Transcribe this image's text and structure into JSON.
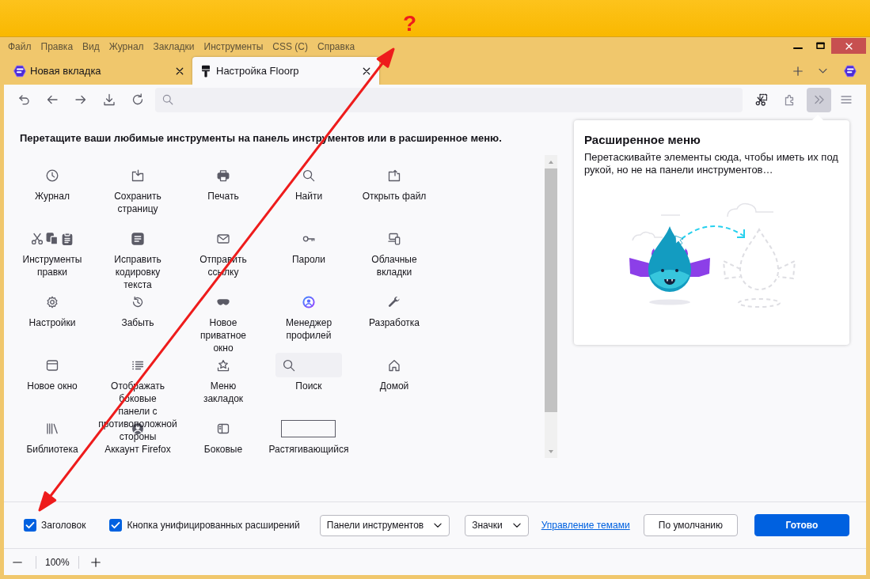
{
  "menu_bar": {
    "items": [
      "Файл",
      "Правка",
      "Вид",
      "Журнал",
      "Закладки",
      "Инструменты",
      "CSS (C)",
      "Справка"
    ]
  },
  "tabs": [
    {
      "title": "Новая вкладка",
      "selected": false
    },
    {
      "title": "Настройка Floorp",
      "selected": true
    }
  ],
  "toolbar": {
    "overflow_button": {
      "active": true
    }
  },
  "customize": {
    "heading": "Перетащите ваши любимые инструменты на панель инструментов или в расширенное меню.",
    "items": [
      {
        "label": "Журнал",
        "kind": "button"
      },
      {
        "label": "Сохранить\nстраницу",
        "kind": "button"
      },
      {
        "label": "Печать",
        "kind": "button"
      },
      {
        "label": "Найти",
        "kind": "button"
      },
      {
        "label": "Открыть файл",
        "kind": "button"
      },
      {
        "label": "Инструменты\nправки",
        "kind": "button"
      },
      {
        "label": "Исправить\nкодировку\nтекста",
        "kind": "button"
      },
      {
        "label": "Отправить\nссылку",
        "kind": "button"
      },
      {
        "label": "Пароли",
        "kind": "button"
      },
      {
        "label": "Облачные\nвкладки",
        "kind": "button"
      },
      {
        "label": "Настройки",
        "kind": "button"
      },
      {
        "label": "Забыть",
        "kind": "button"
      },
      {
        "label": "Новое\nприватное\nокно",
        "kind": "button"
      },
      {
        "label": "Менеджер\nпрофилей",
        "kind": "button"
      },
      {
        "label": "Разработка",
        "kind": "button"
      },
      {
        "label": "Новое окно",
        "kind": "button"
      },
      {
        "label": "Отображать\nбоковые\nпанели с\nпротивоположной\nстороны",
        "kind": "button"
      },
      {
        "label": "Меню\nзакладок",
        "kind": "button"
      },
      {
        "label": "Поиск",
        "kind": "search"
      },
      {
        "label": "Домой",
        "kind": "button"
      },
      {
        "label": "Библиотека",
        "kind": "button"
      },
      {
        "label": "Аккаунт Firefox",
        "kind": "button"
      },
      {
        "label": "Боковые",
        "kind": "button"
      },
      {
        "label": "Растягивающийся",
        "kind": "spring"
      }
    ]
  },
  "overflow_panel": {
    "title": "Расширенное меню",
    "description": "Перетаскивайте элементы сюда, чтобы иметь их под рукой, но не на панели инструментов…"
  },
  "footer": {
    "checkboxes": [
      {
        "label": "Заголовок",
        "checked": true
      },
      {
        "label": "Кнопка унифицированных расширений",
        "checked": true
      }
    ],
    "dropdowns": [
      {
        "value": "Панели инструментов"
      },
      {
        "value": "Значки"
      }
    ],
    "link": "Управление темами",
    "buttons": [
      {
        "label": "По умолчанию",
        "kind": "secondary"
      },
      {
        "label": "Готово",
        "kind": "primary"
      }
    ]
  },
  "zoom": {
    "value": "100%"
  },
  "annotation": {
    "text": "?"
  }
}
